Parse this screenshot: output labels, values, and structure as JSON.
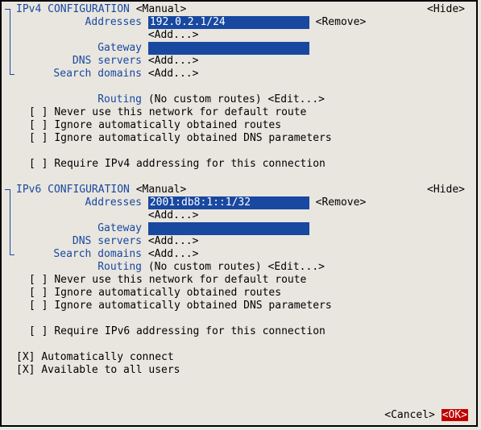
{
  "ipv4": {
    "title": "IPv4 CONFIGURATION",
    "mode": "Manual",
    "hide": "Hide",
    "labels": {
      "addresses": "Addresses",
      "gateway": "Gateway",
      "dns": "DNS servers",
      "search": "Search domains",
      "routing": "Routing"
    },
    "address": "192.0.2.1/24",
    "remove": "Remove",
    "add": "Add...",
    "gateway": "",
    "routing_text": "(No custom routes)",
    "edit": "Edit...",
    "checks": [
      "Never use this network for default route",
      "Ignore automatically obtained routes",
      "Ignore automatically obtained DNS parameters"
    ],
    "require": "Require IPv4 addressing for this connection"
  },
  "ipv6": {
    "title": "IPv6 CONFIGURATION",
    "mode": "Manual",
    "hide": "Hide",
    "labels": {
      "addresses": "Addresses",
      "gateway": "Gateway",
      "dns": "DNS servers",
      "search": "Search domains",
      "routing": "Routing"
    },
    "address": "2001:db8:1::1/32",
    "remove": "Remove",
    "add": "Add...",
    "gateway": "",
    "routing_text": "(No custom routes)",
    "edit": "Edit...",
    "checks": [
      "Never use this network for default route",
      "Ignore automatically obtained routes",
      "Ignore automatically obtained DNS parameters"
    ],
    "require": "Require IPv6 addressing for this connection"
  },
  "global": {
    "auto_connect": "Automatically connect",
    "all_users": "Available to all users",
    "cancel": "Cancel",
    "ok": "OK"
  }
}
